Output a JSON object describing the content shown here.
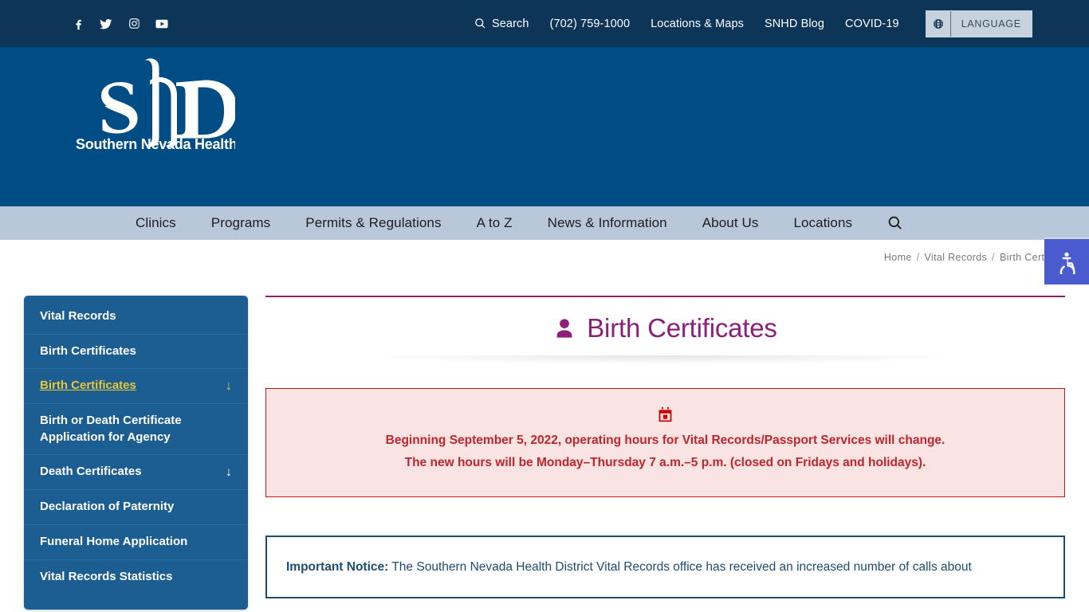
{
  "topbar": {
    "social": [
      {
        "name": "facebook",
        "label": "Facebook"
      },
      {
        "name": "twitter",
        "label": "Twitter"
      },
      {
        "name": "instagram",
        "label": "Instagram"
      },
      {
        "name": "youtube",
        "label": "YouTube"
      }
    ],
    "links": [
      {
        "label": "Search",
        "icon": "search-icon"
      },
      {
        "label": "(702) 759-1000",
        "icon": ""
      },
      {
        "label": "Locations & Maps",
        "icon": ""
      },
      {
        "label": "SNHD Blog",
        "icon": ""
      },
      {
        "label": "COVID-19",
        "icon": ""
      }
    ],
    "language_button": {
      "label": "LANGUAGE",
      "icon": "globe-icon"
    },
    "background_color": "#0d3557"
  },
  "masthead": {
    "logo_initials": "SNHD",
    "logo_subtitle": "Southern Nevada Health District",
    "background_color": "#004c85"
  },
  "mainnav": {
    "items": [
      {
        "label": "Clinics"
      },
      {
        "label": "Programs"
      },
      {
        "label": "Permits & Regulations"
      },
      {
        "label": "A to Z"
      },
      {
        "label": "News & Information"
      },
      {
        "label": "About Us"
      },
      {
        "label": "Locations"
      }
    ],
    "search_icon": "search-icon",
    "background_color": "#b8c8da"
  },
  "breadcrumb": {
    "items": [
      "Home",
      "Vital Records",
      "Birth Certificates"
    ],
    "separator": "/"
  },
  "accessibility_widget": {
    "icon": "wheelchair-accessibility-icon",
    "color": "#4a5bd0"
  },
  "sidebar": {
    "items": [
      {
        "label": "Vital Records",
        "active": false,
        "arrow": ""
      },
      {
        "label": "Birth Certificates",
        "active": false,
        "arrow": ""
      },
      {
        "label": "Birth Certificates",
        "active": true,
        "arrow": "↓"
      },
      {
        "label": "Birth or Death Certificate Application for Agency",
        "active": false,
        "arrow": ""
      },
      {
        "label": "Death Certificates",
        "active": false,
        "arrow": "↓"
      },
      {
        "label": "Declaration of Paternity",
        "active": false,
        "arrow": ""
      },
      {
        "label": "Funeral Home Application",
        "active": false,
        "arrow": ""
      },
      {
        "label": "Vital Records Statistics",
        "active": false,
        "arrow": ""
      }
    ],
    "background_color": "#1c5e91",
    "active_color": "#e8c53a"
  },
  "main": {
    "page_title": "Birth Certificates",
    "page_title_icon": "user-icon",
    "page_title_color": "#8b1f7a",
    "alert": {
      "icon": "calendar-icon",
      "icon_color": "#cc0000",
      "line1": "Beginning September 5, 2022, operating hours for Vital Records/Passport Services will change.",
      "line2": "The new hours will be Monday–Thursday 7 a.m.–5 p.m. (closed on Fridays and holidays).",
      "border_color": "#b81c1c",
      "background_color": "#fae3e3"
    },
    "notice": {
      "label": "Important Notice:",
      "body": "The Southern Nevada Health District Vital Records office has received an increased number of calls about",
      "border_color": "#1b4d72"
    }
  }
}
